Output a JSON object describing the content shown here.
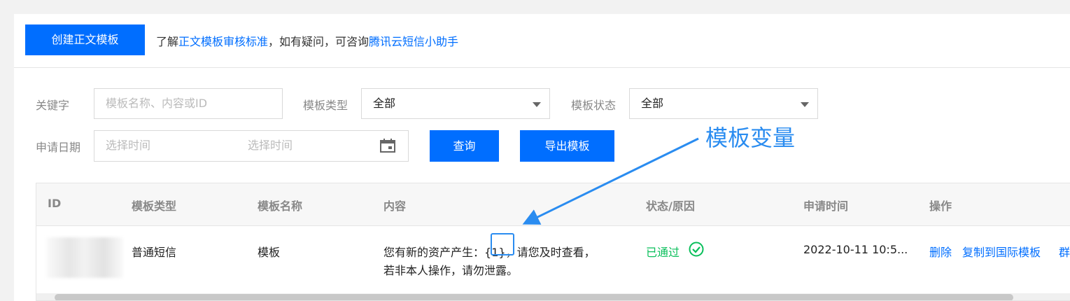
{
  "header": {
    "create_button": "创建正文模板",
    "notice_prefix": "了解",
    "notice_link1": "正文模板审核标准",
    "notice_mid": "，如有疑问，可咨询",
    "notice_link2": "腾讯云短信小助手"
  },
  "filters": {
    "keyword_label": "关键字",
    "keyword_placeholder": "模板名称、内容或ID",
    "type_label": "模板类型",
    "type_value": "全部",
    "status_label": "模板状态",
    "status_value": "全部",
    "date_label": "申请日期",
    "date_start_placeholder": "选择时间",
    "date_end_placeholder": "选择时间",
    "query_button": "查询",
    "export_button": "导出模板"
  },
  "table": {
    "columns": [
      "ID",
      "模板类型",
      "模板名称",
      "内容",
      "状态/原因",
      "申请时间",
      "操作"
    ],
    "rows": [
      {
        "type": "普通短信",
        "name": "模板",
        "content_line1_pre": "您有新的资产产生：",
        "content_var": "{1}",
        "content_line1_post": "，请您及时查看，",
        "content_line2": "若非本人操作，请勿泄露。",
        "status": "已通过",
        "time": "2022-10-11 10:5...",
        "op_delete": "删除",
        "op_copy": "复制到国际模板",
        "op_more": "群"
      }
    ]
  },
  "annotation": {
    "label": "模板变量",
    "color": "#2a8cf0"
  },
  "colors": {
    "primary": "#006eff",
    "success": "#0abf5b"
  }
}
